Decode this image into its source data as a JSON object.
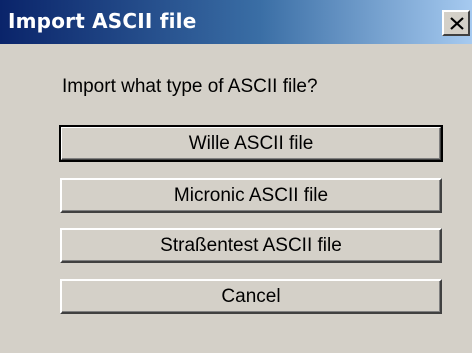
{
  "window": {
    "title": "Import ASCII file",
    "close_label": "X"
  },
  "dialog": {
    "prompt": "Import what type of ASCII file?",
    "buttons": {
      "wille": "Wille ASCII file",
      "micronic": "Micronic ASCII file",
      "strassentest": "Straßentest ASCII file",
      "cancel": "Cancel"
    }
  },
  "colors": {
    "face": "#d4d0c8",
    "title_start": "#0a246a",
    "title_end": "#a6caf0"
  }
}
